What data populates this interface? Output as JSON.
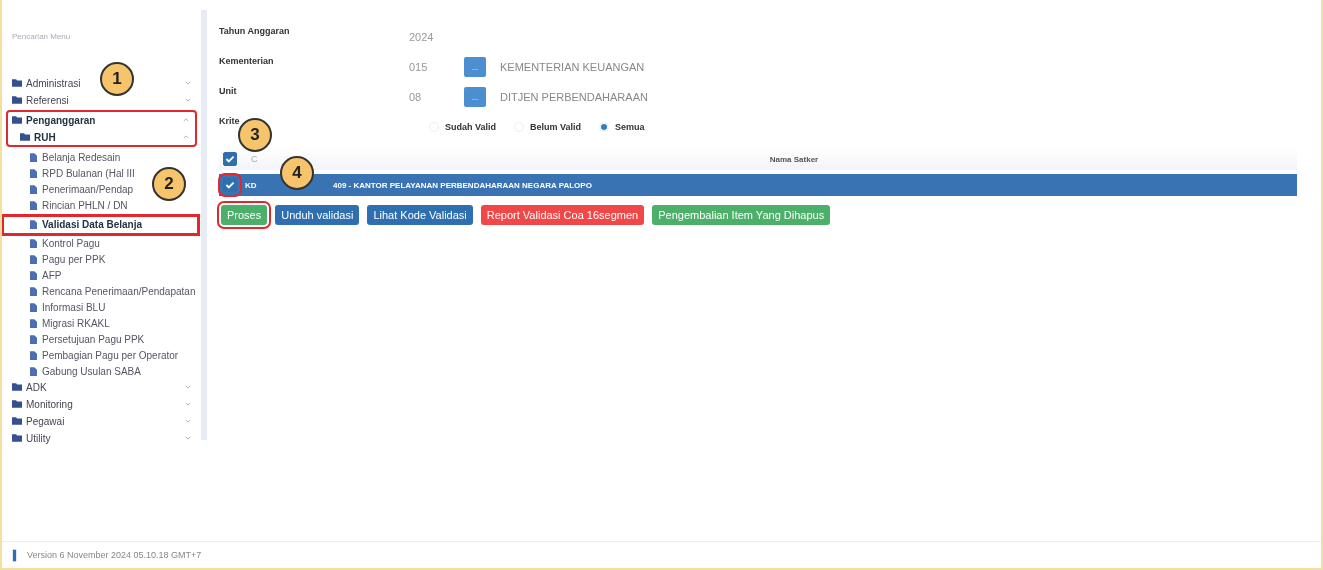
{
  "sidebar": {
    "search": {
      "placeholder": "Pencarian Menu"
    },
    "items": [
      {
        "label": "Administrasi",
        "expanded": false
      },
      {
        "label": "Referensi",
        "expanded": false
      },
      {
        "label": "Penganggaran",
        "expanded": true,
        "children": [
          {
            "label": "RUH",
            "expanded": true,
            "children": [
              {
                "label": "Belanja Redesain",
                "selected": false
              },
              {
                "label": "RPD Bulanan (Hal III",
                "selected": false
              },
              {
                "label": "Penerimaan/Pendap",
                "selected": false
              },
              {
                "label": "Rincian PHLN / DN",
                "selected": false
              },
              {
                "label": "Validasi Data Belanja",
                "selected": true
              },
              {
                "label": "Kontrol Pagu",
                "selected": false
              },
              {
                "label": "Pagu per PPK",
                "selected": false
              },
              {
                "label": "AFP",
                "selected": false
              },
              {
                "label": "Rencana Penerimaan/Pendapatan",
                "selected": false
              },
              {
                "label": "Informasi BLU",
                "selected": false
              },
              {
                "label": "Migrasi RKAKL",
                "selected": false
              },
              {
                "label": "Persetujuan Pagu PPK",
                "selected": false
              },
              {
                "label": "Pembagian Pagu per Operator",
                "selected": false
              },
              {
                "label": "Gabung Usulan SABA",
                "selected": false
              }
            ]
          }
        ]
      },
      {
        "label": "ADK",
        "expanded": false
      },
      {
        "label": "Monitoring",
        "expanded": false
      },
      {
        "label": "Pegawai",
        "expanded": false
      },
      {
        "label": "Utility",
        "expanded": false
      }
    ]
  },
  "form": {
    "fields": [
      {
        "label": "Tahun Anggaran",
        "code": "2024"
      },
      {
        "label": "Kementerian",
        "code": "015",
        "button": "...",
        "name": "KEMENTERIAN KEUANGAN"
      },
      {
        "label": "Unit",
        "code": "08",
        "button": "...",
        "name": "DITJEN PERBENDAHARAAN"
      }
    ],
    "criteria": {
      "label": "Krite",
      "options": [
        {
          "label": "Sudah Valid",
          "selected": false
        },
        {
          "label": "Belum Valid",
          "selected": false
        },
        {
          "label": "Semua",
          "selected": true
        }
      ]
    }
  },
  "table": {
    "header": {
      "checked": true,
      "column_1": "C",
      "column_2": "Nama Satker"
    },
    "rows": [
      {
        "checked": true,
        "selected": true,
        "column_1": "KD",
        "column_2": "409 - KANTOR PELAYANAN PERBENDAHARAAN NEGARA PALOPO"
      }
    ]
  },
  "buttons": [
    {
      "label": "Proses",
      "color": "#4caf6a"
    },
    {
      "label": "Unduh validasi",
      "color": "#2f6fb0"
    },
    {
      "label": "Lihat Kode Validasi",
      "color": "#2f6fb0"
    },
    {
      "label": "Report Validasi Coa 16segmen",
      "color": "#f04848"
    },
    {
      "label": "Pengembalian Item Yang Dihapus",
      "color": "#4caf6a"
    }
  ],
  "callouts": [
    "1",
    "2",
    "3",
    "4"
  ],
  "footer": {
    "version": "Version 6 November 2024 05.10.18 GMT+7"
  }
}
